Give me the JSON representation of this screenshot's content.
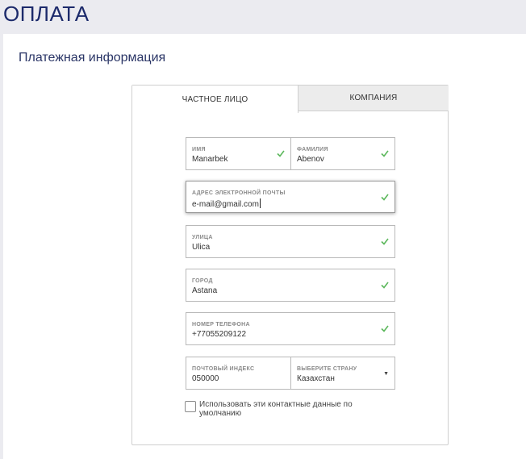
{
  "header": {
    "title": "ОПЛАТА"
  },
  "section": {
    "title": "Платежная информация"
  },
  "tabs": [
    {
      "label": "ЧАСТНОЕ ЛИЦО",
      "active": true
    },
    {
      "label": "КОМПАНИЯ",
      "active": false
    }
  ],
  "fields": {
    "first_name": {
      "label": "ИМЯ",
      "value": "Manarbek",
      "valid": true
    },
    "last_name": {
      "label": "ФАМИЛИЯ",
      "value": "Abenov",
      "valid": true
    },
    "email": {
      "label": "АДРЕС ЭЛЕКТРОННОЙ ПОЧТЫ",
      "value": "e-mail@gmail.com",
      "valid": true,
      "focused": true
    },
    "street": {
      "label": "УЛИЦА",
      "value": "Ulica",
      "valid": true
    },
    "city": {
      "label": "ГОРОД",
      "value": "Astana",
      "valid": true
    },
    "phone": {
      "label": "НОМЕР ТЕЛЕФОНА",
      "value": "+77055209122",
      "valid": true
    },
    "postal_code": {
      "label": "ПОЧТОВЫЙ ИНДЕКС",
      "value": "050000"
    },
    "country": {
      "label": "ВЫБЕРИТЕ СТРАНУ",
      "value": "Казахстан"
    }
  },
  "default_contact_checkbox": {
    "label": "Использовать эти контактные данные по умолчанию",
    "checked": false
  },
  "colors": {
    "title": "#1c2a6b",
    "check": "#5cb85c",
    "header_bg": "#ebebf0"
  }
}
